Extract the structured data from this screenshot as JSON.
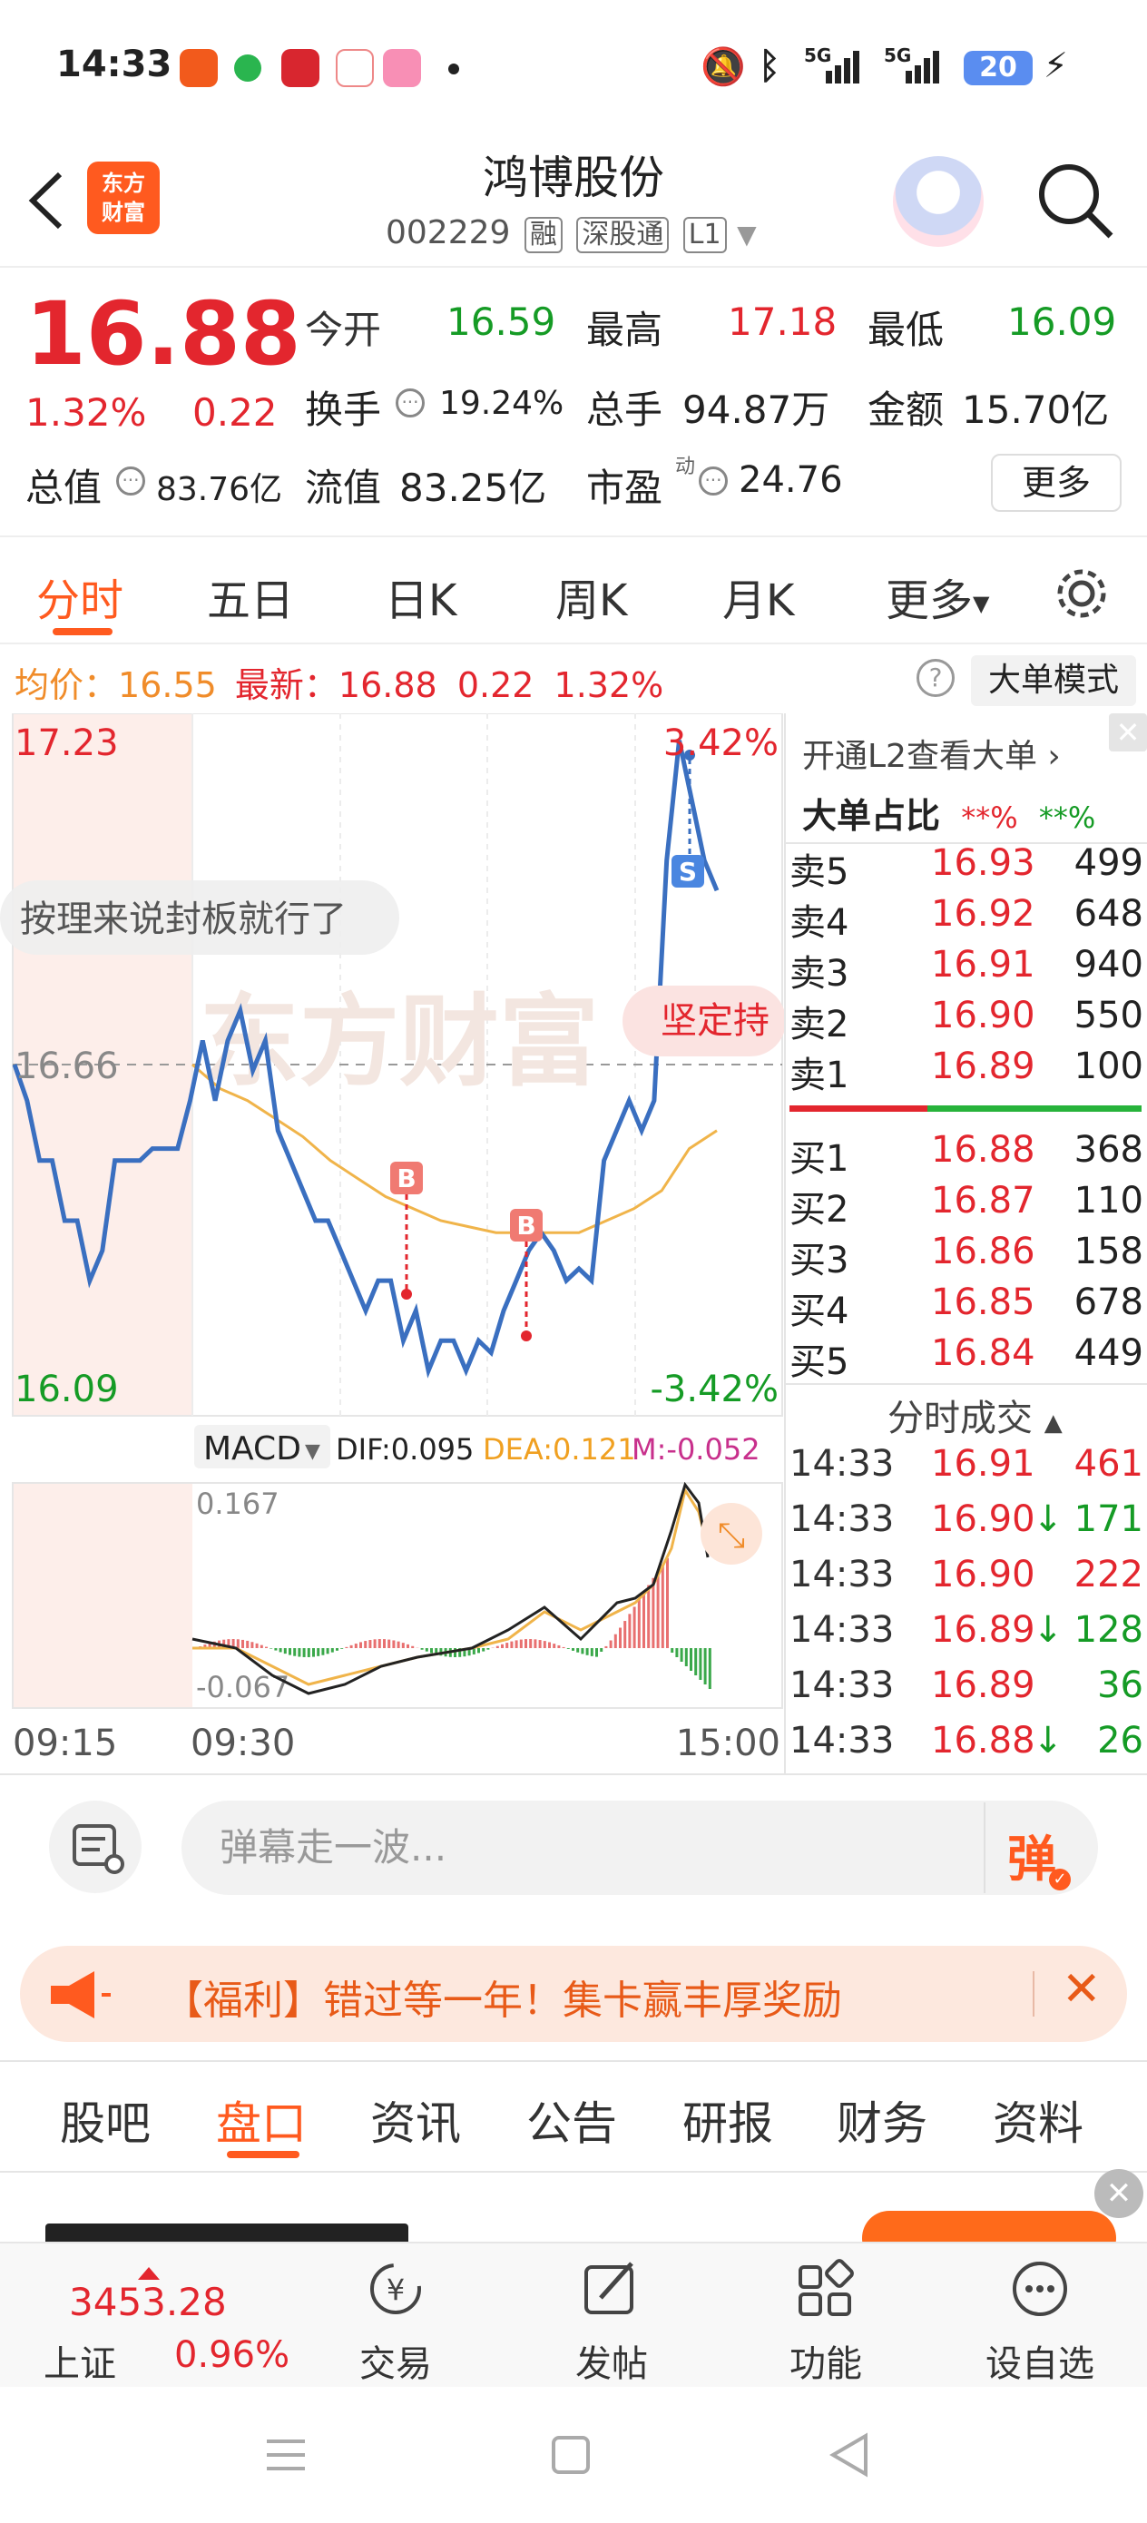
{
  "status_bar": {
    "time": "14:33",
    "battery": "20"
  },
  "header": {
    "stock_name": "鸿博股份",
    "stock_code": "002229",
    "tags": [
      "融",
      "深股通",
      "L1"
    ],
    "logo_text": [
      "东方",
      "财富"
    ]
  },
  "quote": {
    "price": "16.88",
    "change_pct": "1.32%",
    "change_amt": "0.22",
    "open_label": "今开",
    "open": "16.59",
    "high_label": "最高",
    "high": "17.18",
    "low_label": "最低",
    "low": "16.09",
    "turnover_label": "换手",
    "turnover": "19.24%",
    "volume_label": "总手",
    "volume": "94.87万",
    "amount_label": "金额",
    "amount": "15.70亿",
    "mktcap_label": "总值",
    "mktcap": "83.76亿",
    "float_label": "流值",
    "float": "83.25亿",
    "pe_label": "市盈",
    "pe_sup": "动",
    "pe": "24.76",
    "more_button": "更多"
  },
  "chart_tabs": [
    "分时",
    "五日",
    "日K",
    "周K",
    "月K",
    "更多"
  ],
  "intraday_info": {
    "avg_label": "均价：",
    "avg": "16.55",
    "latest_label": "最新：",
    "latest": "16.88",
    "chg": "0.22",
    "pct": "1.32%",
    "mode_button": "大单模式"
  },
  "chart_data": {
    "type": "line",
    "y_top_label": "17.23",
    "y_mid_label": "16.66",
    "y_bottom_label": "16.09",
    "pct_top_label": "3.42%",
    "pct_bottom_label": "-3.42%",
    "ylim": [
      16.09,
      17.23
    ],
    "x_labels": [
      "09:15",
      "09:30",
      "15:00"
    ],
    "series": [
      {
        "values": [
          16.66,
          16.6,
          16.5,
          16.5,
          16.4,
          16.4,
          16.3,
          16.35,
          16.5,
          16.5,
          16.5,
          16.52,
          16.52,
          16.52,
          16.6,
          16.7,
          16.6,
          16.7,
          16.75,
          16.65,
          16.7,
          16.55,
          16.5,
          16.45,
          16.4,
          16.4,
          16.35,
          16.3,
          16.25,
          16.3,
          16.3,
          16.2,
          16.25,
          16.15,
          16.2,
          16.2,
          16.15,
          16.2,
          16.18,
          16.25,
          16.3,
          16.35,
          16.38,
          16.35,
          16.3,
          16.32,
          16.3,
          16.5,
          16.55,
          16.6,
          16.55,
          16.6,
          17.0,
          17.2,
          17.1,
          17.0,
          16.95
        ]
      },
      {
        "values": [
          16.66,
          16.62,
          16.6,
          16.57,
          16.54,
          16.5,
          16.47,
          16.44,
          16.42,
          16.4,
          16.39,
          16.38,
          16.38,
          16.38,
          16.38,
          16.4,
          16.42,
          16.45,
          16.52,
          16.55
        ]
      }
    ],
    "markers": [
      "B",
      "B",
      "S"
    ],
    "watermark": "东方财富",
    "danmaku": [
      "按理来说封板就行了",
      "坚定持"
    ]
  },
  "macd": {
    "label": "MACD",
    "dif": "DIF:0.095",
    "dea": "DEA:0.121",
    "m": "M:-0.052",
    "top": "0.167",
    "bottom": "-0.067"
  },
  "orderbook": {
    "l2_link": "开通L2查看大单",
    "big_ratio_label": "大单占比",
    "big_ratio_a": "**%",
    "big_ratio_b": "**%",
    "asks": [
      {
        "label": "卖5",
        "price": "16.93",
        "vol": "499"
      },
      {
        "label": "卖4",
        "price": "16.92",
        "vol": "648"
      },
      {
        "label": "卖3",
        "price": "16.91",
        "vol": "940"
      },
      {
        "label": "卖2",
        "price": "16.90",
        "vol": "550"
      },
      {
        "label": "卖1",
        "price": "16.89",
        "vol": "100"
      }
    ],
    "bids": [
      {
        "label": "买1",
        "price": "16.88",
        "vol": "368"
      },
      {
        "label": "买2",
        "price": "16.87",
        "vol": "110"
      },
      {
        "label": "买3",
        "price": "16.86",
        "vol": "158"
      },
      {
        "label": "买4",
        "price": "16.85",
        "vol": "678"
      },
      {
        "label": "买5",
        "price": "16.84",
        "vol": "449"
      }
    ]
  },
  "ticks": {
    "title": "分时成交",
    "rows": [
      {
        "time": "14:33",
        "price": "16.91",
        "arrow": "",
        "vol": "461",
        "color": "#e3262e"
      },
      {
        "time": "14:33",
        "price": "16.90",
        "arrow": "↓",
        "vol": "171",
        "color": "#159b25"
      },
      {
        "time": "14:33",
        "price": "16.90",
        "arrow": "",
        "vol": "222",
        "color": "#e3262e"
      },
      {
        "time": "14:33",
        "price": "16.89",
        "arrow": "↓",
        "vol": "128",
        "color": "#159b25"
      },
      {
        "time": "14:33",
        "price": "16.89",
        "arrow": "",
        "vol": "36",
        "color": "#159b25"
      },
      {
        "time": "14:33",
        "price": "16.88",
        "arrow": "↓",
        "vol": "26",
        "color": "#159b25"
      }
    ]
  },
  "comment": {
    "placeholder": "弹幕走一波...",
    "danmu_button": "弹"
  },
  "promo": {
    "text": "【福利】错过等一年！集卡赢丰厚奖励"
  },
  "bottom_tabs": [
    "股吧",
    "盘口",
    "资讯",
    "公告",
    "研报",
    "财务",
    "资料"
  ],
  "index": {
    "value": "3453.28",
    "name": "上证",
    "pct": "0.96%"
  },
  "nav": [
    "交易",
    "发帖",
    "功能",
    "设自选"
  ]
}
